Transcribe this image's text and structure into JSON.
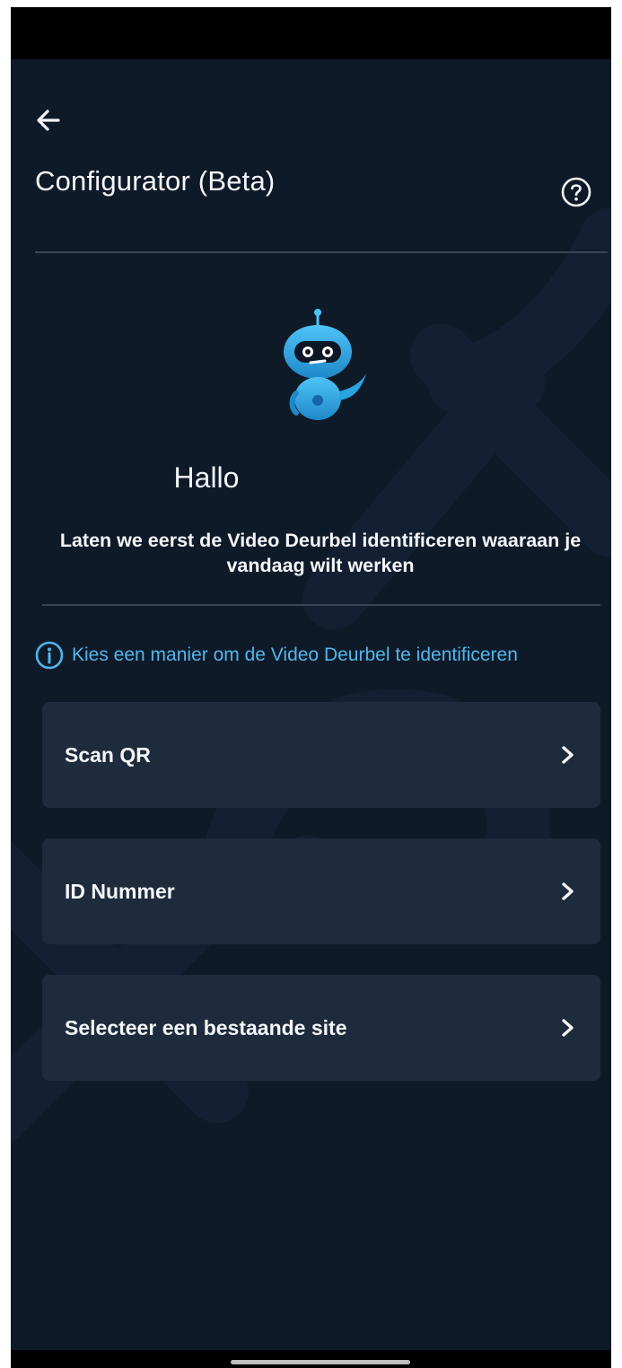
{
  "header": {
    "back_icon": "arrow-left-icon",
    "title": "Configurator (Beta)",
    "help_icon": "question-circle-icon"
  },
  "hero": {
    "mascot_icon": "robot-mascot-icon",
    "greeting": "Hallo",
    "intro": "Laten we eerst de Video Deurbel identificeren waaraan je vandaag wilt werken"
  },
  "info": {
    "icon": "info-circle-icon",
    "text": "Kies een manier om de Video Deurbel te identificeren",
    "color": "#52b6ec"
  },
  "options": [
    {
      "label": "Scan QR"
    },
    {
      "label": "ID Nummer"
    },
    {
      "label": "Selecteer een bestaande site"
    }
  ],
  "colors": {
    "background": "#0f1a29",
    "card": "#1d2b3c",
    "accent": "#52b6ec",
    "text": "#f4f6f9"
  }
}
